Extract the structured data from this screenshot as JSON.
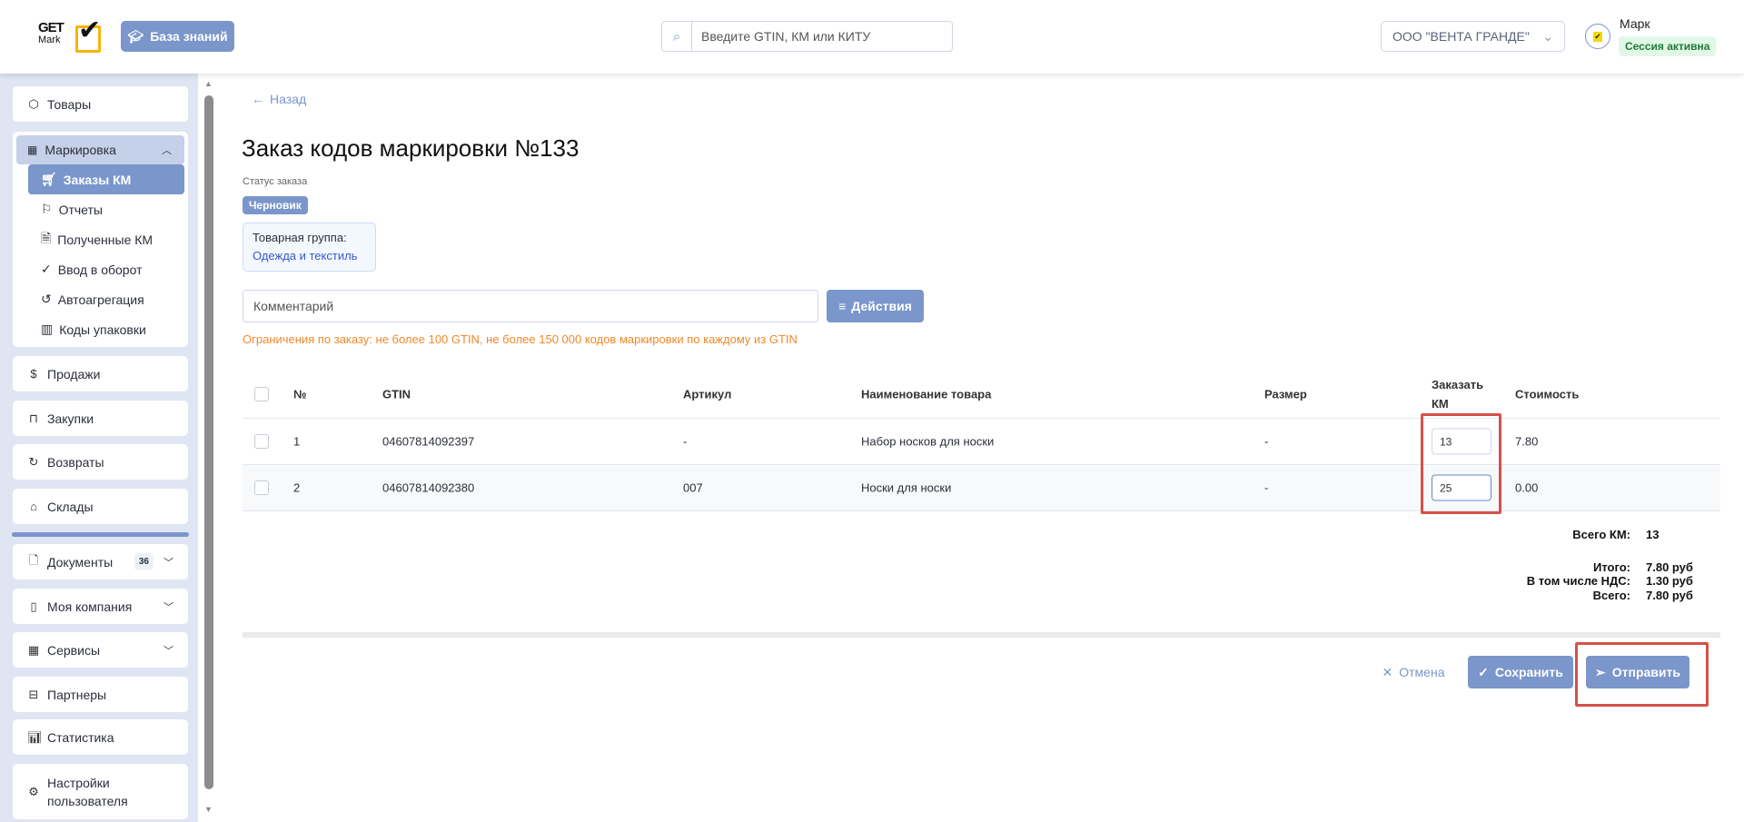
{
  "header": {
    "logo_text": "GET Mark",
    "knowledge_base_label": "База знаний",
    "search_placeholder": "Введите GTIN, КМ или КИТУ",
    "organization": "ООО \"ВЕНТА ГРАНДЕ\"",
    "user_name": "Марк",
    "session_status": "Сессия активна"
  },
  "sidebar": {
    "items_top": [
      {
        "label": "Товары",
        "icon": "box-icon"
      }
    ],
    "marking": {
      "label": "Маркировка",
      "children": [
        {
          "label": "Заказы КМ",
          "icon": "cart-icon",
          "active": true
        },
        {
          "label": "Отчеты",
          "icon": "flag-icon"
        },
        {
          "label": "Полученные КМ",
          "icon": "document-check-icon"
        },
        {
          "label": "Ввод в оборот",
          "icon": "check-circle-icon"
        },
        {
          "label": "Автоагрегация",
          "icon": "history-icon"
        },
        {
          "label": "Коды упаковки",
          "icon": "barcode-icon"
        }
      ]
    },
    "items": [
      {
        "label": "Продажи",
        "icon": "dollar-icon"
      },
      {
        "label": "Закупки",
        "icon": "bag-icon"
      },
      {
        "label": "Возвраты",
        "icon": "return-icon"
      },
      {
        "label": "Склады",
        "icon": "warehouse-icon"
      }
    ],
    "items_bottom": [
      {
        "label": "Документы",
        "icon": "file-icon",
        "count": "36"
      },
      {
        "label": "Моя компания",
        "icon": "building-icon"
      },
      {
        "label": "Сервисы",
        "icon": "grid-icon"
      },
      {
        "label": "Партнеры",
        "icon": "briefcase-icon"
      },
      {
        "label": "Статистика",
        "icon": "chart-icon"
      },
      {
        "label": "Настройки пользователя",
        "icon": "gear-icon"
      }
    ]
  },
  "main": {
    "back_label": "Назад",
    "title": "Заказ кодов маркировки №133",
    "status_label": "Статус заказа",
    "status": "Черновик",
    "product_group_label": "Товарная группа:",
    "product_group": "Одежда и текстиль",
    "comment_placeholder": "Комментарий",
    "actions_label": "Действия",
    "limits_text": "Ограничения по заказу: не более 100 GTIN, не более 150 000 кодов маркировки по каждому из GTIN",
    "table": {
      "columns": [
        "№",
        "GTIN",
        "Артикул",
        "Наименование товара",
        "Размер",
        "Заказать КМ",
        "Стоимость"
      ],
      "rows": [
        {
          "no": "1",
          "gtin": "04607814092397",
          "article": "-",
          "name": "Набор носков для носки",
          "size": "-",
          "order_km": "13",
          "cost": "7.80"
        },
        {
          "no": "2",
          "gtin": "04607814092380",
          "article": "007",
          "name": "Носки для носки",
          "size": "-",
          "order_km": "25",
          "cost": "0.00"
        }
      ]
    },
    "totals": {
      "total_km_label": "Всего КМ:",
      "total_km": "13",
      "subtotal_label": "Итого:",
      "subtotal": "7.80 руб",
      "vat_label": "В том числе НДС:",
      "vat": "1.30 руб",
      "grand_label": "Всего:",
      "grand": "7.80 руб"
    },
    "buttons": {
      "cancel": "Отмена",
      "save": "Сохранить",
      "send": "Отправить"
    }
  },
  "colors": {
    "accent": "#7b96cb",
    "sidebar_bg": "#dfe5f2",
    "warning": "#f0892a",
    "highlight": "#d5514a",
    "session_bg": "#e2f8e6"
  }
}
